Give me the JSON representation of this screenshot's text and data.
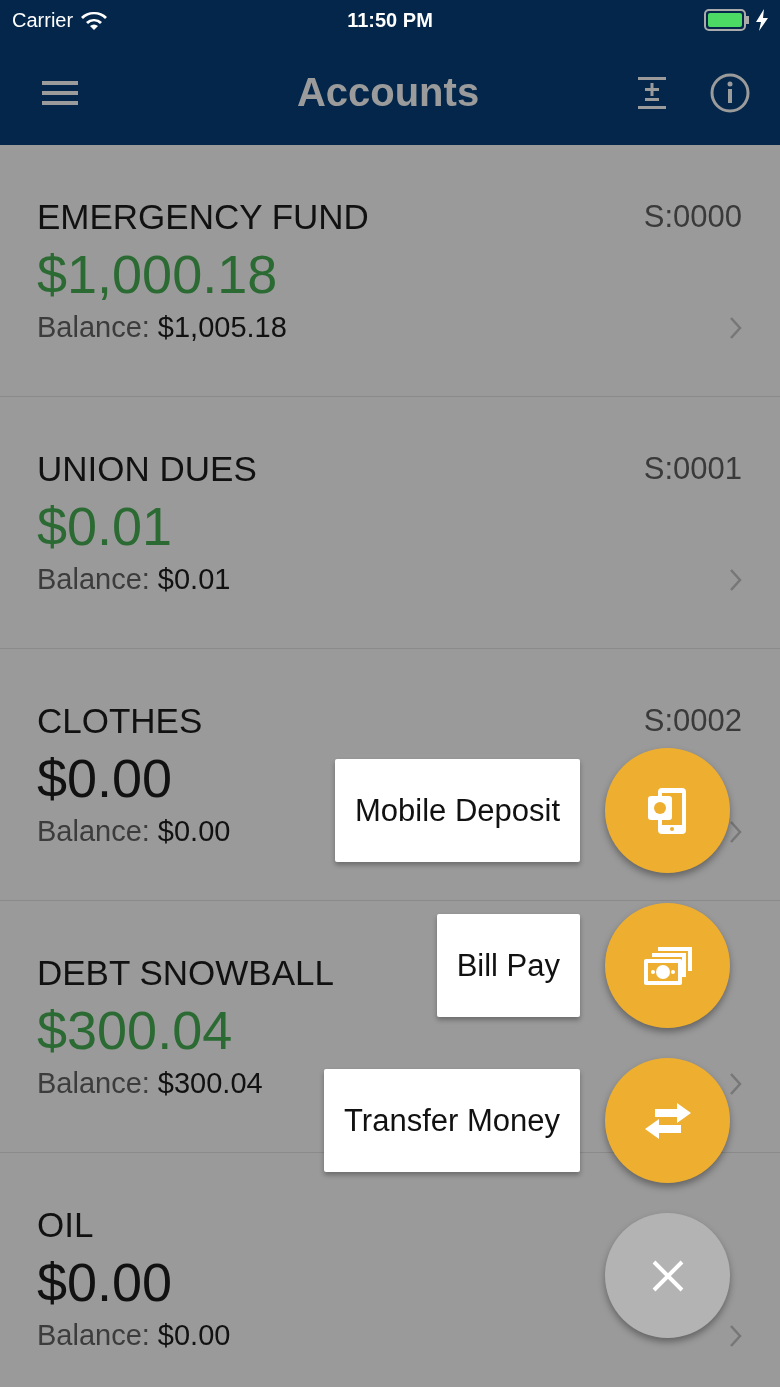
{
  "status_bar": {
    "carrier": "Carrier",
    "time": "11:50 PM"
  },
  "nav_bar": {
    "title": "Accounts"
  },
  "accounts": [
    {
      "name": "EMERGENCY FUND",
      "number": "S:0000",
      "amount": "$1,000.18",
      "kind": "funded",
      "balance_label": "Balance:",
      "balance": "$1,005.18"
    },
    {
      "name": "UNION DUES",
      "number": "S:0001",
      "amount": "$0.01",
      "kind": "funded",
      "balance_label": "Balance:",
      "balance": "$0.01"
    },
    {
      "name": "CLOTHES",
      "number": "S:0002",
      "amount": "$0.00",
      "kind": "empty",
      "balance_label": "Balance:",
      "balance": "$0.00"
    },
    {
      "name": "DEBT SNOWBALL",
      "amount": "$300.04",
      "kind": "funded",
      "balance_label": "Balance:",
      "balance": "$300.04"
    },
    {
      "name": "OIL",
      "amount": "$0.00",
      "kind": "empty",
      "balance_label": "Balance:",
      "balance": "$0.00"
    }
  ],
  "actions": [
    {
      "label": "Mobile Deposit",
      "kind": "deposit"
    },
    {
      "label": "Bill Pay",
      "kind": "bill"
    },
    {
      "label": "Transfer Money",
      "kind": "transfer"
    }
  ]
}
